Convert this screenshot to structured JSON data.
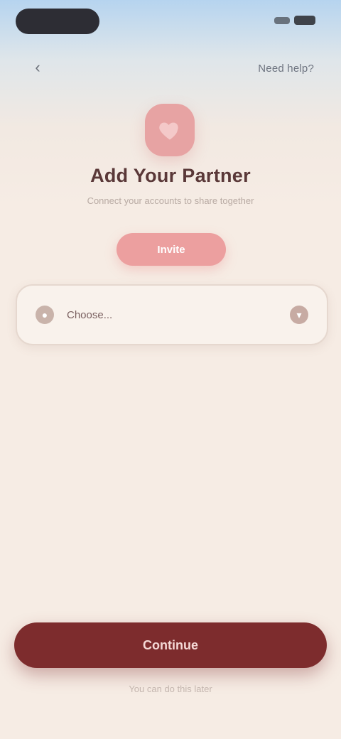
{
  "nav": {
    "back_icon": "chevron-left-icon",
    "right_link": "Need help?"
  },
  "hero": {
    "icon": "heart-icon",
    "title": "Add Your Partner",
    "subtitle": "Connect your accounts to share together",
    "cta_label": "Invite"
  },
  "select": {
    "lead_icon": "user-icon",
    "label": "Choose...",
    "trail_icon": "chevron-down-icon"
  },
  "footer": {
    "primary_label": "Continue",
    "note": "You can do this later"
  },
  "colors": {
    "background": "#f6ece4",
    "accent_pink": "#ec9f9f",
    "primary": "#7d2c2d",
    "title": "#5a3838"
  }
}
